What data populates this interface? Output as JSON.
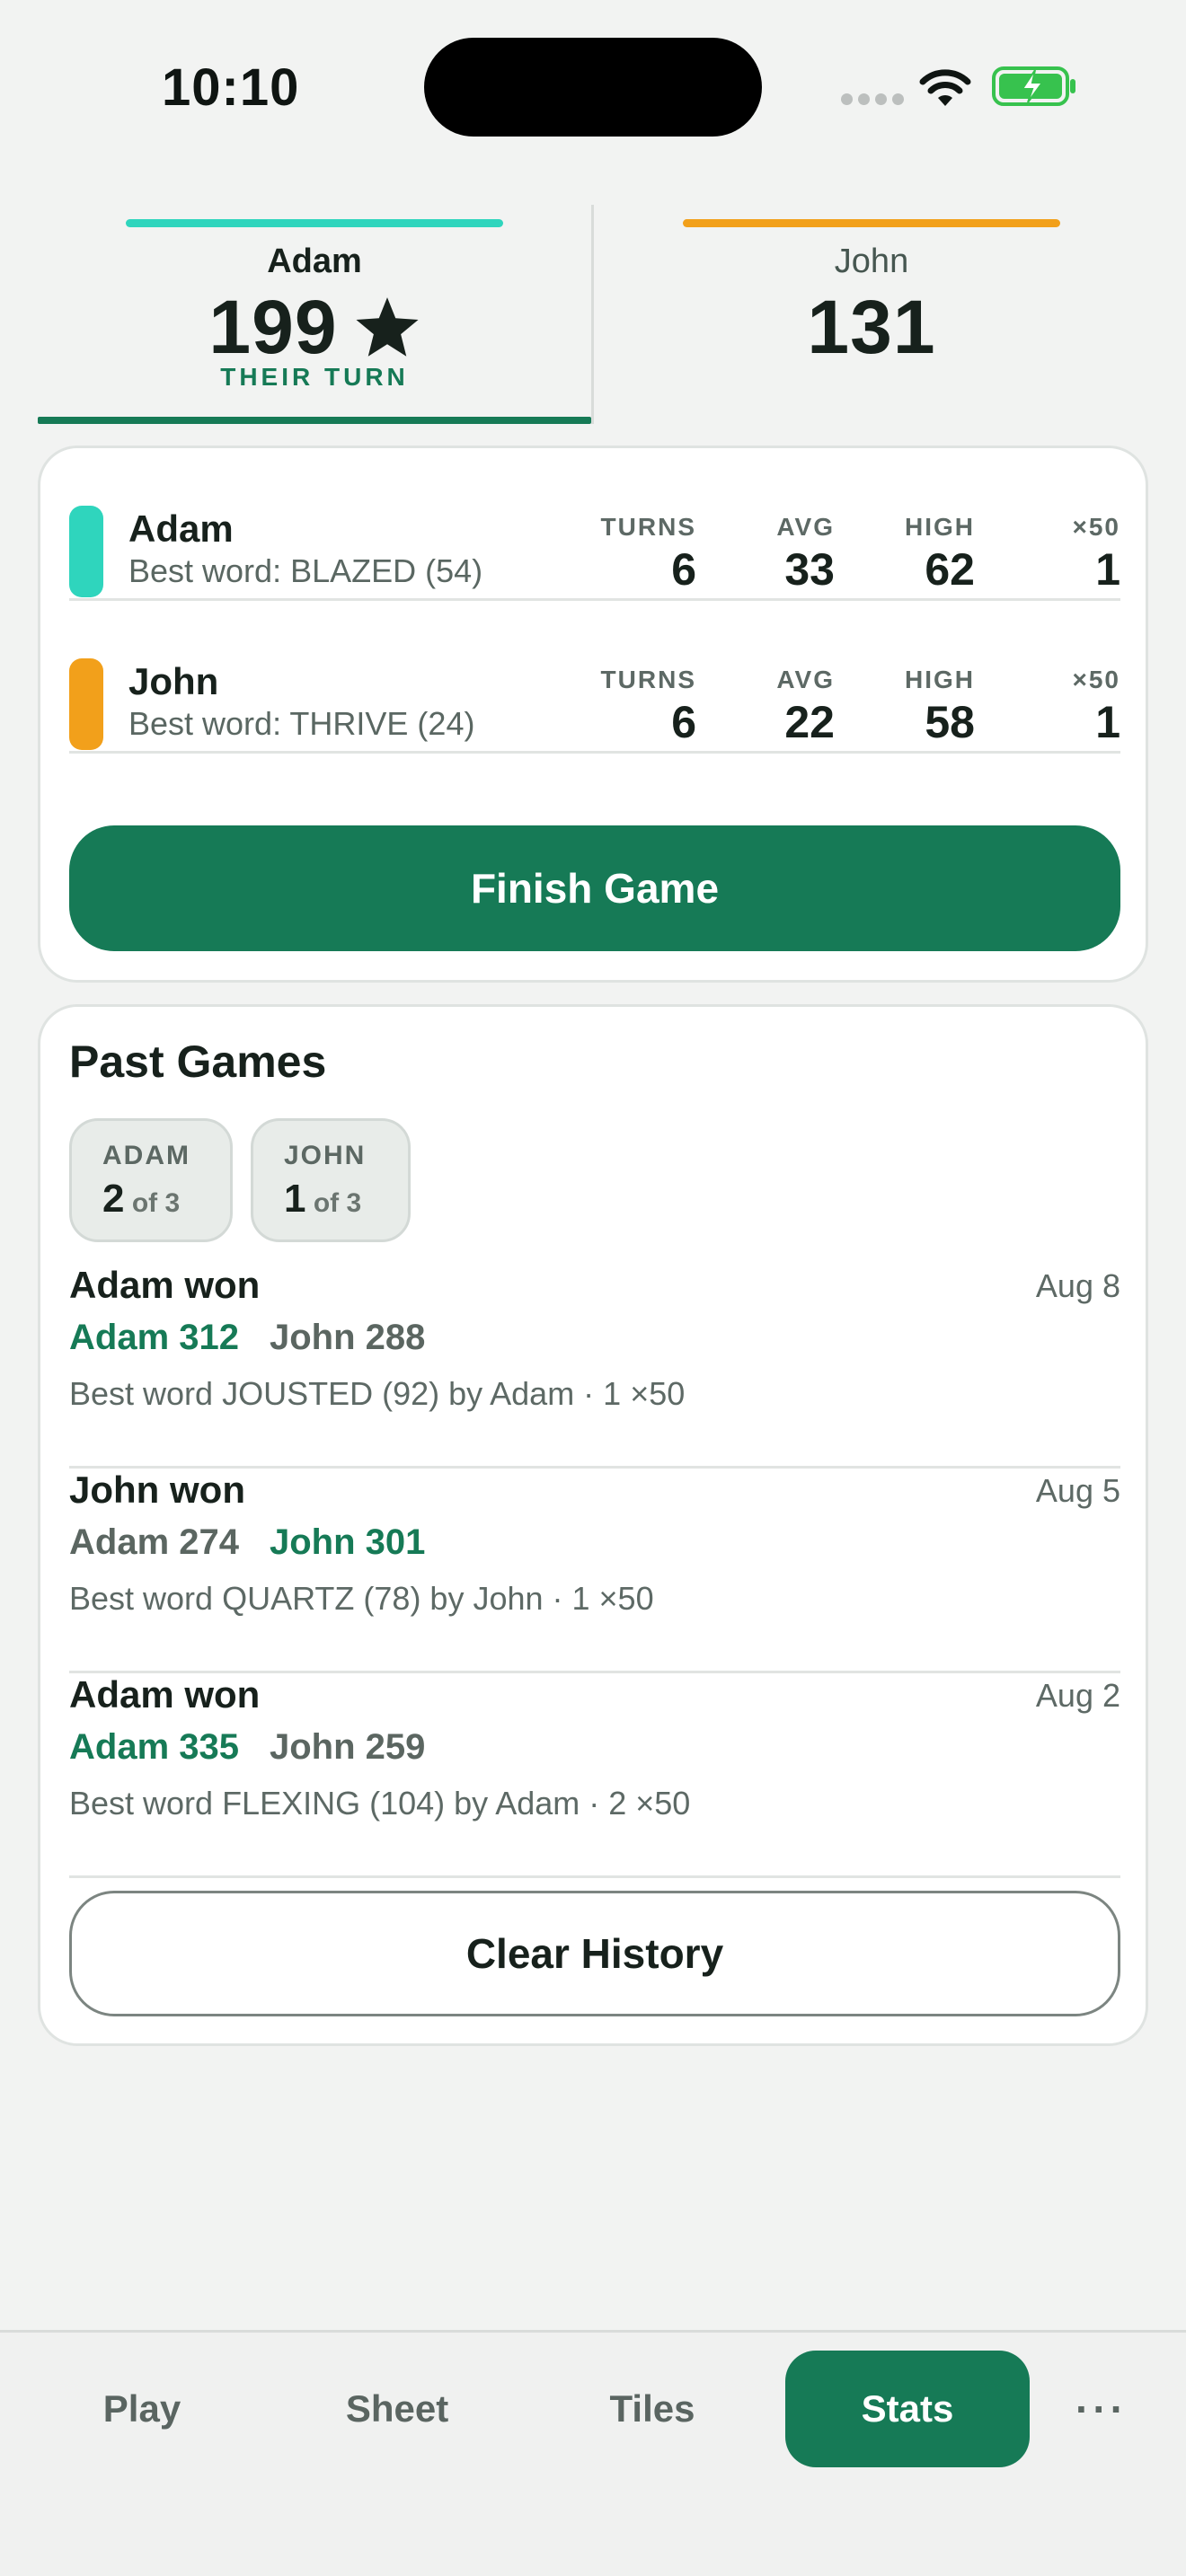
{
  "status_bar": {
    "time": "10:10"
  },
  "players": [
    {
      "name": "Adam",
      "score": "199",
      "turn_label": "THEIR TURN",
      "color": "#2fd5bd",
      "active": true
    },
    {
      "name": "John",
      "score": "131",
      "color": "#f2a01b",
      "active": false
    }
  ],
  "stats": {
    "headers": {
      "turns": "TURNS",
      "avg": "AVG",
      "high": "HIGH",
      "x50": "×50"
    },
    "rows": [
      {
        "name": "Adam",
        "best_word": "Best word: BLAZED (54)",
        "turns": "6",
        "avg": "33",
        "high": "62",
        "x50": "1"
      },
      {
        "name": "John",
        "best_word": "Best word: THRIVE (24)",
        "turns": "6",
        "avg": "22",
        "high": "58",
        "x50": "1"
      }
    ],
    "finish_label": "Finish Game"
  },
  "past_games": {
    "title": "Past Games",
    "records": [
      {
        "name": "ADAM",
        "wins": "2",
        "of_label": "of 3"
      },
      {
        "name": "JOHN",
        "wins": "1",
        "of_label": "of 3"
      }
    ],
    "games": [
      {
        "winner": "Adam won",
        "date": "Aug 8",
        "score_a": "Adam 312",
        "score_b": "John 288",
        "best": "Best word JOUSTED (92) by Adam · 1 ×50"
      },
      {
        "winner": "John won",
        "date": "Aug 5",
        "score_a": "Adam 274",
        "score_b": "John 301",
        "best": "Best word QUARTZ (78) by John · 1 ×50"
      },
      {
        "winner": "Adam won",
        "date": "Aug 2",
        "score_a": "Adam 335",
        "score_b": "John 259",
        "best": "Best word FLEXING (104) by Adam · 2 ×50"
      }
    ],
    "clear_label": "Clear History"
  },
  "tabs": [
    {
      "label": "Play"
    },
    {
      "label": "Sheet"
    },
    {
      "label": "Tiles"
    },
    {
      "label": "Stats",
      "selected": true
    },
    {
      "label": "···"
    }
  ],
  "colors": {
    "accent": "#167a56",
    "adam": "#2fd5bd",
    "john": "#f2a01b"
  }
}
